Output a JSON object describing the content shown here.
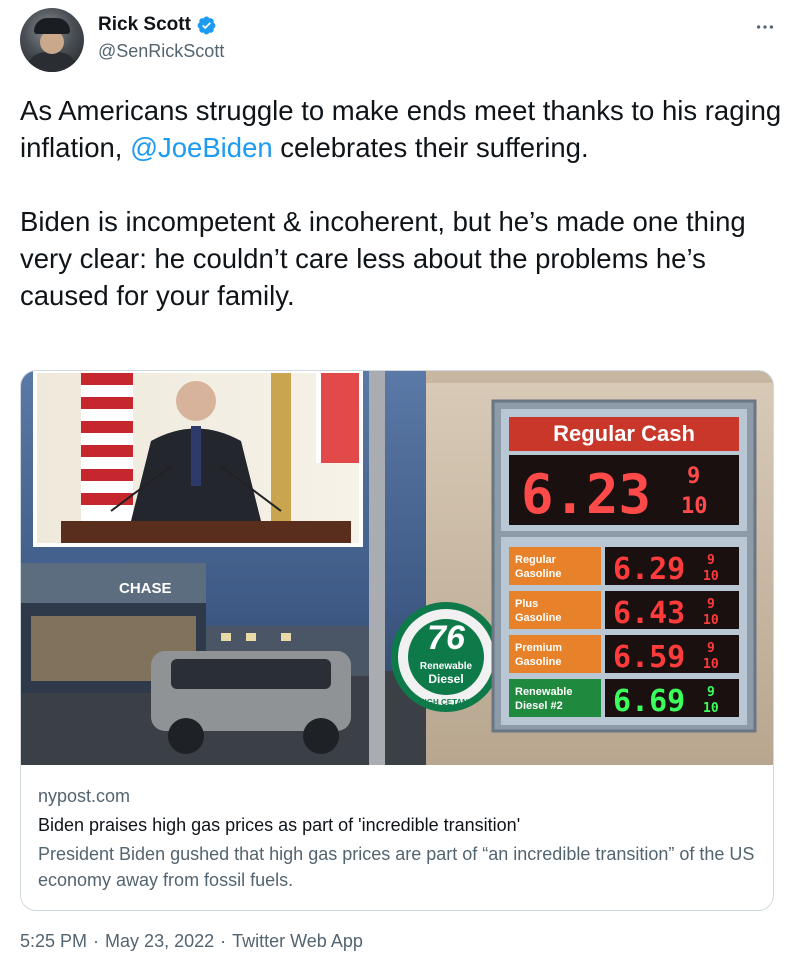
{
  "author": {
    "display_name": "Rick Scott",
    "handle": "@SenRickScott",
    "verified": true
  },
  "tweet": {
    "line1_before": "As Americans struggle to make ends meet thanks to his raging inflation, ",
    "mention": "@JoeBiden",
    "line1_after": " celebrates their suffering.",
    "paragraph2": "Biden is incompetent & incoherent, but he’s made one thing very clear: he couldn’t care less about the problems he’s caused for your family."
  },
  "card": {
    "domain": "nypost.com",
    "title": "Biden praises high gas prices as part of 'incredible transition'",
    "description": "President Biden gushed that high gas prices are part of “an incredible transition” of the US economy away from fossil fuels.",
    "image": {
      "bank_sign": "CHASE",
      "station_logo": "76",
      "station_logo_sub1": "Renewable",
      "station_logo_sub2": "Diesel",
      "station_logo_ring": "HIGH CETANE",
      "board_header": "Regular Cash",
      "board_main_price": "6.23",
      "board_main_fraction_top": "9",
      "board_main_fraction_bottom": "10",
      "rows": [
        {
          "label": "Regular Gasoline",
          "price": "6.29",
          "fraction_top": "9",
          "fraction_bottom": "10",
          "color": "#ff3b3b"
        },
        {
          "label": "Plus Gasoline",
          "price": "6.43",
          "fraction_top": "9",
          "fraction_bottom": "10",
          "color": "#ff3b3b"
        },
        {
          "label": "Premium Gasoline",
          "price": "6.59",
          "fraction_top": "9",
          "fraction_bottom": "10",
          "color": "#ff3b3b"
        },
        {
          "label": "Renewable Diesel #2",
          "price": "6.69",
          "fraction_top": "9",
          "fraction_bottom": "10",
          "color": "#3bff5a"
        }
      ]
    }
  },
  "footer": {
    "time": "5:25 PM",
    "separator": "·",
    "date": "May 23, 2022",
    "source": "Twitter Web App"
  },
  "colors": {
    "link": "#1d9bf0",
    "secondary_text": "#536471",
    "primary_text": "#0f1419",
    "border": "#cfd9de",
    "verified_badge": "#1d9bf0"
  },
  "icons": [
    "verified-badge-icon",
    "more-options-icon"
  ]
}
